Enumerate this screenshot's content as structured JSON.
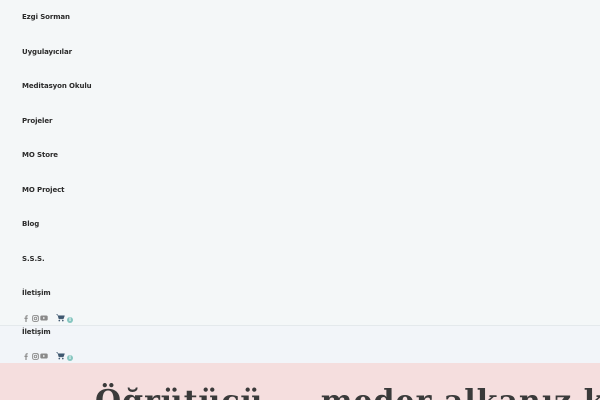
{
  "nav": {
    "brand": "Ezgi Sorman",
    "items": [
      "Uygulayıcılar",
      "Meditasyon Okulu",
      "Projeler",
      "MO Store",
      "MO Project",
      "Blog",
      "S.S.S.",
      "İletişim"
    ]
  },
  "toolbar": {
    "social": [
      {
        "name": "facebook",
        "glyph": "f"
      },
      {
        "name": "instagram",
        "glyph": "◎"
      },
      {
        "name": "youtube",
        "glyph": "▶"
      }
    ],
    "cart_count": "0"
  },
  "sticky": {
    "item": "İletişim",
    "cart_count": "0"
  },
  "hero": {
    "title": "Öğrütücü ... meder alkanız kanış ardı"
  },
  "colors": {
    "background": "#f4f7f8",
    "hero_background": "#f5dede",
    "accent": "#86c6c0",
    "text": "#2b2b2b"
  }
}
